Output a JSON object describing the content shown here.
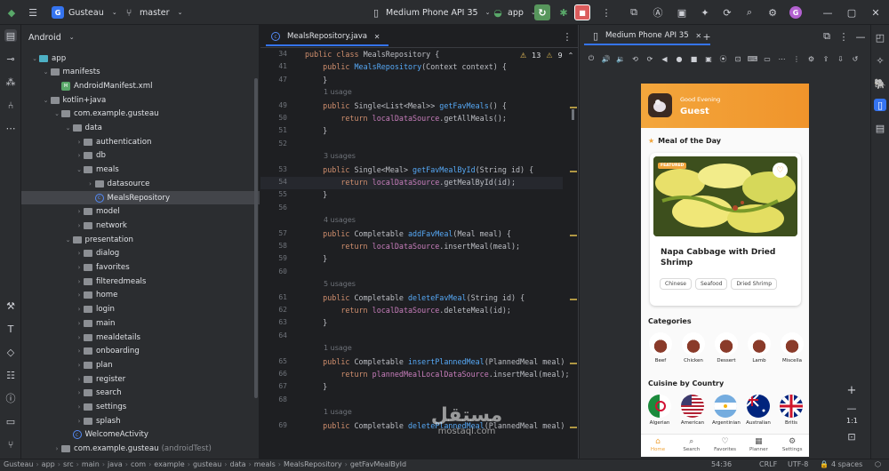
{
  "topbar": {
    "project_badge": "G",
    "project": "Gusteau",
    "branch": "master",
    "device": "Medium Phone API 35",
    "run_config": "app",
    "avatar": "G"
  },
  "project_panel": {
    "title": "Android",
    "items": [
      {
        "label": "app",
        "suffix": "",
        "depth": 0,
        "kind": "folder-teal",
        "expanded": true
      },
      {
        "label": "manifests",
        "suffix": "",
        "depth": 1,
        "kind": "folder",
        "expanded": true
      },
      {
        "label": "AndroidManifest.xml",
        "suffix": "",
        "depth": 2,
        "kind": "xml",
        "expanded": null
      },
      {
        "label": "kotlin+java",
        "suffix": "",
        "depth": 1,
        "kind": "folder",
        "expanded": true
      },
      {
        "label": "com.example.gusteau",
        "suffix": "",
        "depth": 2,
        "kind": "folder",
        "expanded": true
      },
      {
        "label": "data",
        "suffix": "",
        "depth": 3,
        "kind": "folder",
        "expanded": true
      },
      {
        "label": "authentication",
        "suffix": "",
        "depth": 4,
        "kind": "folder",
        "expanded": false
      },
      {
        "label": "db",
        "suffix": "",
        "depth": 4,
        "kind": "folder",
        "expanded": false
      },
      {
        "label": "meals",
        "suffix": "",
        "depth": 4,
        "kind": "folder",
        "expanded": true
      },
      {
        "label": "datasource",
        "suffix": "",
        "depth": 5,
        "kind": "folder",
        "expanded": false
      },
      {
        "label": "MealsRepository",
        "suffix": "",
        "depth": 5,
        "kind": "class",
        "expanded": null,
        "selected": true
      },
      {
        "label": "model",
        "suffix": "",
        "depth": 4,
        "kind": "folder",
        "expanded": false
      },
      {
        "label": "network",
        "suffix": "",
        "depth": 4,
        "kind": "folder",
        "expanded": false
      },
      {
        "label": "presentation",
        "suffix": "",
        "depth": 3,
        "kind": "folder",
        "expanded": true
      },
      {
        "label": "dialog",
        "suffix": "",
        "depth": 4,
        "kind": "folder",
        "expanded": false
      },
      {
        "label": "favorites",
        "suffix": "",
        "depth": 4,
        "kind": "folder",
        "expanded": false
      },
      {
        "label": "filteredmeals",
        "suffix": "",
        "depth": 4,
        "kind": "folder",
        "expanded": false
      },
      {
        "label": "home",
        "suffix": "",
        "depth": 4,
        "kind": "folder",
        "expanded": false
      },
      {
        "label": "login",
        "suffix": "",
        "depth": 4,
        "kind": "folder",
        "expanded": false
      },
      {
        "label": "main",
        "suffix": "",
        "depth": 4,
        "kind": "folder",
        "expanded": false
      },
      {
        "label": "mealdetails",
        "suffix": "",
        "depth": 4,
        "kind": "folder",
        "expanded": false
      },
      {
        "label": "onboarding",
        "suffix": "",
        "depth": 4,
        "kind": "folder",
        "expanded": false
      },
      {
        "label": "plan",
        "suffix": "",
        "depth": 4,
        "kind": "folder",
        "expanded": false
      },
      {
        "label": "register",
        "suffix": "",
        "depth": 4,
        "kind": "folder",
        "expanded": false
      },
      {
        "label": "search",
        "suffix": "",
        "depth": 4,
        "kind": "folder",
        "expanded": false
      },
      {
        "label": "settings",
        "suffix": "",
        "depth": 4,
        "kind": "folder",
        "expanded": false
      },
      {
        "label": "splash",
        "suffix": "",
        "depth": 4,
        "kind": "folder",
        "expanded": false
      },
      {
        "label": "WelcomeActivity",
        "suffix": "",
        "depth": 3,
        "kind": "class",
        "expanded": null
      },
      {
        "label": "com.example.gusteau",
        "suffix": "(androidTest)",
        "depth": 2,
        "kind": "folder",
        "expanded": false
      }
    ]
  },
  "editor": {
    "tab": "MealsRepository.java",
    "warnings": "13",
    "weak_warnings": "9",
    "lines": [
      {
        "n": "34",
        "usage": "",
        "code": "public class MealsRepository {"
      },
      {
        "n": "41",
        "usage": "",
        "code": "    public MealsRepository(Context context) {"
      },
      {
        "n": "47",
        "usage": "",
        "code": "    }"
      },
      {
        "n": "",
        "usage": "1 usage",
        "code": ""
      },
      {
        "n": "49",
        "usage": "",
        "code": "    public Single<List<Meal>> getFavMeals() {"
      },
      {
        "n": "50",
        "usage": "",
        "code": "        return localDataSource.getAllMeals();"
      },
      {
        "n": "51",
        "usage": "",
        "code": "    }"
      },
      {
        "n": "52",
        "usage": "",
        "code": ""
      },
      {
        "n": "",
        "usage": "3 usages",
        "code": ""
      },
      {
        "n": "53",
        "usage": "",
        "code": "    public Single<Meal> getFavMealById(String id) {"
      },
      {
        "n": "54",
        "usage": "",
        "code": "        return localDataSource.getMealById(id);"
      },
      {
        "n": "55",
        "usage": "",
        "code": "    }"
      },
      {
        "n": "56",
        "usage": "",
        "code": ""
      },
      {
        "n": "",
        "usage": "4 usages",
        "code": ""
      },
      {
        "n": "57",
        "usage": "",
        "code": "    public Completable addFavMeal(Meal meal) {"
      },
      {
        "n": "58",
        "usage": "",
        "code": "        return localDataSource.insertMeal(meal);"
      },
      {
        "n": "59",
        "usage": "",
        "code": "    }"
      },
      {
        "n": "60",
        "usage": "",
        "code": ""
      },
      {
        "n": "",
        "usage": "5 usages",
        "code": ""
      },
      {
        "n": "61",
        "usage": "",
        "code": "    public Completable deleteFavMeal(String id) {"
      },
      {
        "n": "62",
        "usage": "",
        "code": "        return localDataSource.deleteMeal(id);"
      },
      {
        "n": "63",
        "usage": "",
        "code": "    }"
      },
      {
        "n": "64",
        "usage": "",
        "code": ""
      },
      {
        "n": "",
        "usage": "1 usage",
        "code": ""
      },
      {
        "n": "65",
        "usage": "",
        "code": "    public Completable insertPlannedMeal(PlannedMeal meal)"
      },
      {
        "n": "66",
        "usage": "",
        "code": "        return plannedMealLocalDataSource.insertMeal(meal);"
      },
      {
        "n": "67",
        "usage": "",
        "code": "    }"
      },
      {
        "n": "68",
        "usage": "",
        "code": ""
      },
      {
        "n": "",
        "usage": "1 usage",
        "code": ""
      },
      {
        "n": "69",
        "usage": "",
        "code": "    public Completable deletePlannedMeal(PlannedMeal meal)"
      }
    ]
  },
  "emulator": {
    "tab": "Medium Phone API 35",
    "zoom": "1:1"
  },
  "app": {
    "greeting": "Good Evening",
    "user": "Guest",
    "meal_of_day_label": "Meal of the Day",
    "featured_badge": "FEATURED",
    "meal_title": "Napa Cabbage with Dried Shrimp",
    "tags": [
      "Chinese",
      "Seafood",
      "Dried Shrimp"
    ],
    "categories_label": "Categories",
    "categories": [
      "Beef",
      "Chicken",
      "Dessert",
      "Lamb",
      "Miscella"
    ],
    "countries_label": "Cuisine by Country",
    "countries": [
      "Algerian",
      "American",
      "Argentinian",
      "Australian",
      "Britis"
    ],
    "nav": [
      {
        "icon": "home-icon",
        "label": "Home"
      },
      {
        "icon": "search-icon",
        "label": "Search"
      },
      {
        "icon": "heart-icon",
        "label": "Favorites"
      },
      {
        "icon": "calendar-icon",
        "label": "Planner"
      },
      {
        "icon": "gear-icon",
        "label": "Settings"
      }
    ]
  },
  "status": {
    "breadcrumb": [
      "Gusteau",
      "app",
      "src",
      "main",
      "java",
      "com",
      "example",
      "gusteau",
      "data",
      "meals",
      "MealsRepository",
      "getFavMealById"
    ],
    "position": "54:36",
    "line_sep": "CRLF",
    "encoding": "UTF-8",
    "indent": "4 spaces"
  },
  "watermark": {
    "line1": "مستقل",
    "line2": "mostaql.com"
  },
  "colors": {
    "accent": "#3574f0",
    "app_orange": "#f0a43a",
    "code_keyword": "#cf8e6d",
    "code_function": "#56a8f5",
    "code_field": "#c77dbb"
  }
}
